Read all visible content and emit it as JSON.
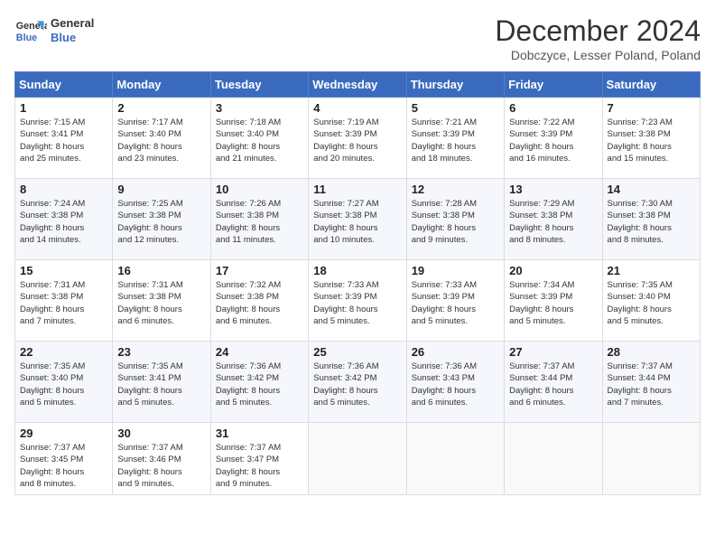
{
  "header": {
    "logo_line1": "General",
    "logo_line2": "Blue",
    "month": "December 2024",
    "location": "Dobczyce, Lesser Poland, Poland"
  },
  "weekdays": [
    "Sunday",
    "Monday",
    "Tuesday",
    "Wednesday",
    "Thursday",
    "Friday",
    "Saturday"
  ],
  "weeks": [
    [
      {
        "day": "1",
        "info": "Sunrise: 7:15 AM\nSunset: 3:41 PM\nDaylight: 8 hours\nand 25 minutes."
      },
      {
        "day": "2",
        "info": "Sunrise: 7:17 AM\nSunset: 3:40 PM\nDaylight: 8 hours\nand 23 minutes."
      },
      {
        "day": "3",
        "info": "Sunrise: 7:18 AM\nSunset: 3:40 PM\nDaylight: 8 hours\nand 21 minutes."
      },
      {
        "day": "4",
        "info": "Sunrise: 7:19 AM\nSunset: 3:39 PM\nDaylight: 8 hours\nand 20 minutes."
      },
      {
        "day": "5",
        "info": "Sunrise: 7:21 AM\nSunset: 3:39 PM\nDaylight: 8 hours\nand 18 minutes."
      },
      {
        "day": "6",
        "info": "Sunrise: 7:22 AM\nSunset: 3:39 PM\nDaylight: 8 hours\nand 16 minutes."
      },
      {
        "day": "7",
        "info": "Sunrise: 7:23 AM\nSunset: 3:38 PM\nDaylight: 8 hours\nand 15 minutes."
      }
    ],
    [
      {
        "day": "8",
        "info": "Sunrise: 7:24 AM\nSunset: 3:38 PM\nDaylight: 8 hours\nand 14 minutes."
      },
      {
        "day": "9",
        "info": "Sunrise: 7:25 AM\nSunset: 3:38 PM\nDaylight: 8 hours\nand 12 minutes."
      },
      {
        "day": "10",
        "info": "Sunrise: 7:26 AM\nSunset: 3:38 PM\nDaylight: 8 hours\nand 11 minutes."
      },
      {
        "day": "11",
        "info": "Sunrise: 7:27 AM\nSunset: 3:38 PM\nDaylight: 8 hours\nand 10 minutes."
      },
      {
        "day": "12",
        "info": "Sunrise: 7:28 AM\nSunset: 3:38 PM\nDaylight: 8 hours\nand 9 minutes."
      },
      {
        "day": "13",
        "info": "Sunrise: 7:29 AM\nSunset: 3:38 PM\nDaylight: 8 hours\nand 8 minutes."
      },
      {
        "day": "14",
        "info": "Sunrise: 7:30 AM\nSunset: 3:38 PM\nDaylight: 8 hours\nand 8 minutes."
      }
    ],
    [
      {
        "day": "15",
        "info": "Sunrise: 7:31 AM\nSunset: 3:38 PM\nDaylight: 8 hours\nand 7 minutes."
      },
      {
        "day": "16",
        "info": "Sunrise: 7:31 AM\nSunset: 3:38 PM\nDaylight: 8 hours\nand 6 minutes."
      },
      {
        "day": "17",
        "info": "Sunrise: 7:32 AM\nSunset: 3:38 PM\nDaylight: 8 hours\nand 6 minutes."
      },
      {
        "day": "18",
        "info": "Sunrise: 7:33 AM\nSunset: 3:39 PM\nDaylight: 8 hours\nand 5 minutes."
      },
      {
        "day": "19",
        "info": "Sunrise: 7:33 AM\nSunset: 3:39 PM\nDaylight: 8 hours\nand 5 minutes."
      },
      {
        "day": "20",
        "info": "Sunrise: 7:34 AM\nSunset: 3:39 PM\nDaylight: 8 hours\nand 5 minutes."
      },
      {
        "day": "21",
        "info": "Sunrise: 7:35 AM\nSunset: 3:40 PM\nDaylight: 8 hours\nand 5 minutes."
      }
    ],
    [
      {
        "day": "22",
        "info": "Sunrise: 7:35 AM\nSunset: 3:40 PM\nDaylight: 8 hours\nand 5 minutes."
      },
      {
        "day": "23",
        "info": "Sunrise: 7:35 AM\nSunset: 3:41 PM\nDaylight: 8 hours\nand 5 minutes."
      },
      {
        "day": "24",
        "info": "Sunrise: 7:36 AM\nSunset: 3:42 PM\nDaylight: 8 hours\nand 5 minutes."
      },
      {
        "day": "25",
        "info": "Sunrise: 7:36 AM\nSunset: 3:42 PM\nDaylight: 8 hours\nand 5 minutes."
      },
      {
        "day": "26",
        "info": "Sunrise: 7:36 AM\nSunset: 3:43 PM\nDaylight: 8 hours\nand 6 minutes."
      },
      {
        "day": "27",
        "info": "Sunrise: 7:37 AM\nSunset: 3:44 PM\nDaylight: 8 hours\nand 6 minutes."
      },
      {
        "day": "28",
        "info": "Sunrise: 7:37 AM\nSunset: 3:44 PM\nDaylight: 8 hours\nand 7 minutes."
      }
    ],
    [
      {
        "day": "29",
        "info": "Sunrise: 7:37 AM\nSunset: 3:45 PM\nDaylight: 8 hours\nand 8 minutes."
      },
      {
        "day": "30",
        "info": "Sunrise: 7:37 AM\nSunset: 3:46 PM\nDaylight: 8 hours\nand 9 minutes."
      },
      {
        "day": "31",
        "info": "Sunrise: 7:37 AM\nSunset: 3:47 PM\nDaylight: 8 hours\nand 9 minutes."
      },
      {
        "day": "",
        "info": ""
      },
      {
        "day": "",
        "info": ""
      },
      {
        "day": "",
        "info": ""
      },
      {
        "day": "",
        "info": ""
      }
    ]
  ]
}
